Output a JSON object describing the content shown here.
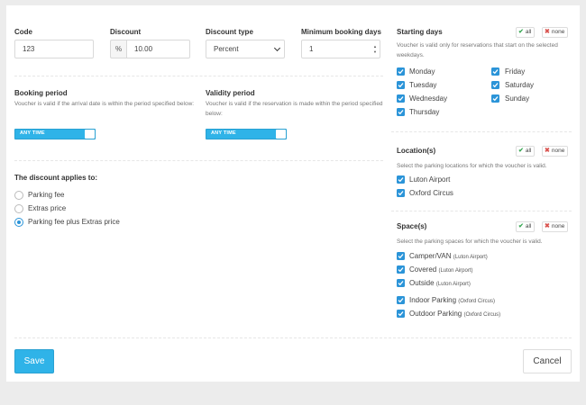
{
  "form": {
    "code": {
      "label": "Code",
      "value": "123"
    },
    "discount": {
      "label": "Discount",
      "addon": "%",
      "value": "10.00"
    },
    "discount_type": {
      "label": "Discount type",
      "value": "Percent"
    },
    "min_days": {
      "label": "Minimum booking days",
      "value": "1"
    },
    "booking_period": {
      "label": "Booking period",
      "help": "Voucher is valid if the arrival date is within the period specified below:",
      "toggle": "ANY TIME"
    },
    "validity_period": {
      "label": "Validity period",
      "help": "Voucher is valid if the reservation is made within the period specified below:",
      "toggle": "ANY TIME"
    },
    "applies": {
      "label": "The discount applies to:",
      "options": [
        "Parking fee",
        "Extras price",
        "Parking fee plus Extras price"
      ],
      "selected": 2
    }
  },
  "starting_days": {
    "label": "Starting days",
    "all": "all",
    "none": "none",
    "help": "Voucher is valid only for reservations that start on the selected weekdays.",
    "days": [
      "Monday",
      "Tuesday",
      "Wednesday",
      "Thursday",
      "Friday",
      "Saturday",
      "Sunday"
    ]
  },
  "locations": {
    "label": "Location(s)",
    "all": "all",
    "none": "none",
    "help": "Select the parking locations for which the voucher is valid.",
    "items": [
      "Luton Airport",
      "Oxford Circus"
    ]
  },
  "spaces": {
    "label": "Space(s)",
    "all": "all",
    "none": "none",
    "help": "Select the parking spaces for which the voucher is valid.",
    "items": [
      {
        "name": "Camper/VAN",
        "loc": "(Luton Airport)"
      },
      {
        "name": "Covered",
        "loc": "(Luton Airport)"
      },
      {
        "name": "Outside",
        "loc": "(Luton Airport)"
      },
      {
        "name": "Indoor Parking",
        "loc": "(Oxford Circus)"
      },
      {
        "name": "Outdoor Parking",
        "loc": "(Oxford Circus)"
      }
    ]
  },
  "actions": {
    "save": "Save",
    "cancel": "Cancel"
  },
  "colors": {
    "accent": "#2fb3e8",
    "checkbox": "#2b94d8",
    "check_green": "#3aa855",
    "x_red": "#d9534f"
  }
}
